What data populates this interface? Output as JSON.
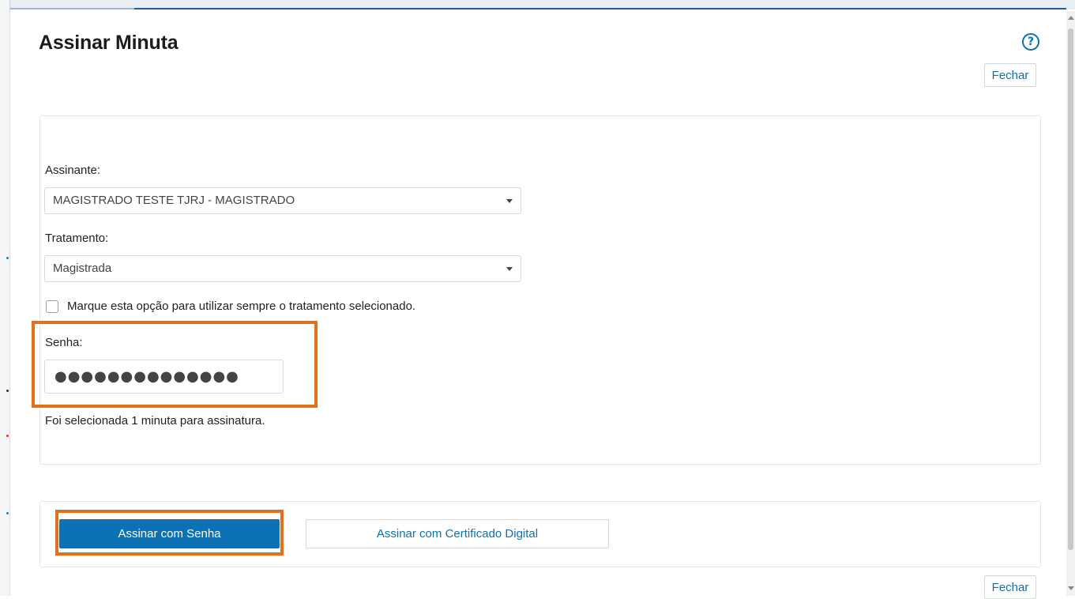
{
  "modal": {
    "title": "Assinar Minuta",
    "help_icon": "question-circle-icon",
    "close_label": "Fechar"
  },
  "form": {
    "assinante": {
      "label": "Assinante:",
      "value": "MAGISTRADO TESTE TJRJ - MAGISTRADO"
    },
    "tratamento": {
      "label": "Tratamento:",
      "value": "Magistrada"
    },
    "always_use_checkbox": {
      "label": "Marque esta opção para utilizar sempre o tratamento selecionado.",
      "checked": false
    },
    "senha": {
      "label": "Senha:",
      "masked_value": "●●●●●●●●●●●●●●"
    },
    "info_text": "Foi selecionada 1 minuta para assinatura."
  },
  "actions": {
    "sign_password_label": "Assinar com Senha",
    "sign_certificate_label": "Assinar com Certificado Digital"
  },
  "colors": {
    "accent": "#0a72b5",
    "highlight": "#e0711f"
  }
}
